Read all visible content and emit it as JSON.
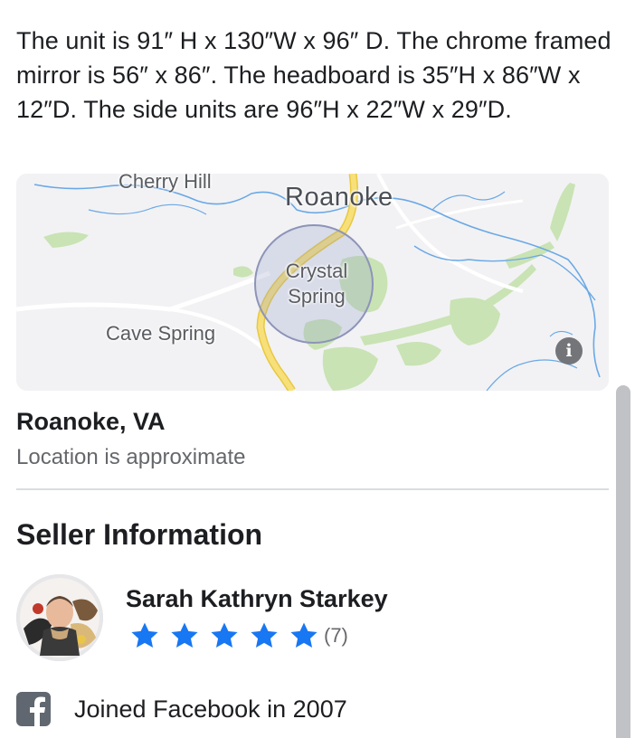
{
  "listing": {
    "description": "The unit is 91″ H x 130″W x 96″ D. The chrome framed mirror is 56″ x 86″. The headboard is 35″H x 86″W x 12″D. The side units are 96″H x 22″W x 29″D."
  },
  "map": {
    "labels": {
      "cherry_hill": "Cherry Hill",
      "roanoke": "Roanoke",
      "crystal": "Crystal",
      "spring": "Spring",
      "cave_spring": "Cave Spring"
    },
    "info_icon": "info-icon",
    "info_glyph": "i"
  },
  "location": {
    "name": "Roanoke, VA",
    "note": "Location is approximate"
  },
  "seller": {
    "section_title": "Seller Information",
    "name": "Sarah Kathryn Starkey",
    "rating_stars": 5,
    "rating_count": "(7)",
    "joined": "Joined Facebook in 2007",
    "joined_icon": "facebook-icon",
    "avatar_icon": "avatar"
  },
  "colors": {
    "star": "#1877f2",
    "map_water": "#6aa8e6",
    "map_park": "#c9e3b4",
    "map_highway": "#f5d85a",
    "map_circle_fill": "rgba(150,160,200,0.28)",
    "map_circle_stroke": "#8d94b8"
  }
}
